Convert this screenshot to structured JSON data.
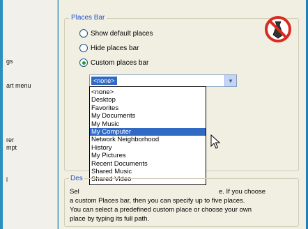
{
  "left_pane": {
    "fragments": [
      "gs",
      "art menu",
      "rer",
      "mpt",
      "l"
    ]
  },
  "places_bar": {
    "title": "Places Bar",
    "options": [
      {
        "label": "Show default places",
        "checked": false
      },
      {
        "label": "Hide places bar",
        "checked": false
      },
      {
        "label": "Custom places bar",
        "checked": true
      }
    ],
    "combo_value": "<none>",
    "dropdown_items": [
      "<none>",
      "Desktop",
      "Favorites",
      "My Documents",
      "My Music",
      "My Computer",
      "Network Neighborhood",
      "History",
      "My Pictures",
      "Recent Documents",
      "Shared Music",
      "Shared Video"
    ],
    "selected_item": "My Computer"
  },
  "description": {
    "title": "Des",
    "line1_start": "Sel",
    "line1_end": "e.  If you choose",
    "line2": "a custom Places bar, then you can specify up to five places.",
    "line3": "You can select a predefined custom place or choose your own",
    "line4": "place by typing its full path."
  },
  "colors": {
    "selection": "#316ac5",
    "group_title": "#2250d0",
    "background": "#2f8ec0"
  },
  "icons": {
    "no_symbol": "no-tie-icon",
    "cursor": "mouse-pointer-icon"
  }
}
